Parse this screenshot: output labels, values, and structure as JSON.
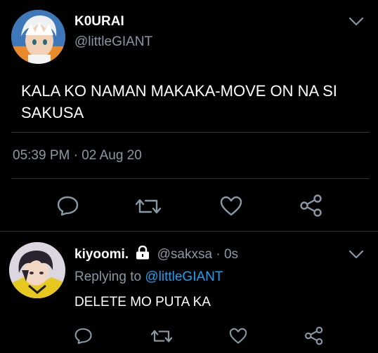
{
  "main_tweet": {
    "display_name": "K0URAI",
    "handle": "@littleGIANT",
    "text": "KALA KO NAMAN MAKAKA-MOVE ON NA SI SAKUSA",
    "time": "05:39 PM",
    "separator": "·",
    "date": "02 Aug 20",
    "avatar_icon": "anime-avatar-white-hair",
    "actions": [
      "reply-icon",
      "retweet-icon",
      "like-icon",
      "share-icon"
    ]
  },
  "reply_tweet": {
    "display_name": "kiyoomi.",
    "lock_icon": "lock-icon",
    "handle": "@sakxsa",
    "separator": "·",
    "age": "0s",
    "replying_prefix": "Replying to",
    "replying_handle": "@littleGIANT",
    "text": "DELETE MO PUTA KA",
    "avatar_icon": "anime-avatar-dark-hair",
    "actions": [
      "reply-icon",
      "retweet-icon",
      "like-icon",
      "share-icon"
    ]
  },
  "colors": {
    "background": "#000000",
    "muted": "#8899a6",
    "link": "#1da1f2",
    "divider": "#2f3336"
  }
}
